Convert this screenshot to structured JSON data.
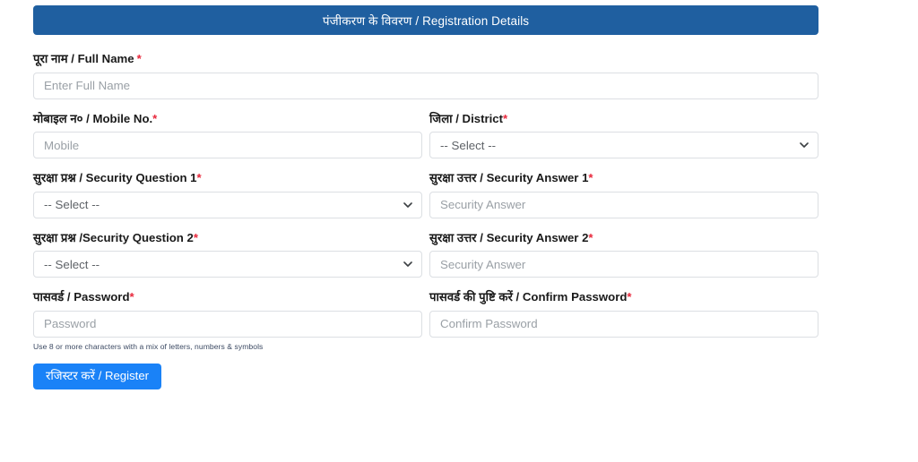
{
  "header": {
    "title": "पंजीकरण के विवरण / Registration Details",
    "bg_color": "#1f5fa0"
  },
  "colors": {
    "required_asterisk": "#e8283c",
    "header_bar": "#1f5fa0",
    "primary_button": "#1a82f7",
    "input_border": "#dcdfe3",
    "placeholder_text": "#9aa0a6"
  },
  "form": {
    "full_name": {
      "label": "पूरा नाम / Full Name",
      "required_marker": "*",
      "placeholder": "Enter Full Name",
      "value": ""
    },
    "mobile_no": {
      "label": "मोबाइल न० / Mobile No.",
      "required_marker": "*",
      "placeholder": "Mobile",
      "value": ""
    },
    "district": {
      "label": "जिला / District",
      "required_marker": "*",
      "selected": "-- Select --",
      "icon": "chevron-down-icon"
    },
    "security_question_1": {
      "label": "सुरक्षा प्रश्न / Security Question 1",
      "required_marker": "*",
      "selected": "-- Select --",
      "icon": "chevron-down-icon"
    },
    "security_answer_1": {
      "label": "सुरक्षा उत्तर / Security Answer 1",
      "required_marker": "*",
      "placeholder": "Security Answer",
      "value": ""
    },
    "security_question_2": {
      "label": "सुरक्षा प्रश्न /Security Question 2",
      "required_marker": "*",
      "selected": "-- Select --",
      "icon": "chevron-down-icon"
    },
    "security_answer_2": {
      "label": "सुरक्षा उत्तर / Security Answer 2",
      "required_marker": "*",
      "placeholder": "Security Answer",
      "value": ""
    },
    "password": {
      "label": "पासवर्ड / Password",
      "required_marker": "*",
      "placeholder": "Password",
      "value": "",
      "help_text": "Use 8 or more characters with a mix of letters, numbers & symbols"
    },
    "confirm_password": {
      "label": "पासवर्ड की पुष्टि करें / Confirm Password",
      "required_marker": "*",
      "placeholder": "Confirm Password",
      "value": ""
    },
    "submit": {
      "label": "रजिस्टर करें / Register"
    }
  }
}
